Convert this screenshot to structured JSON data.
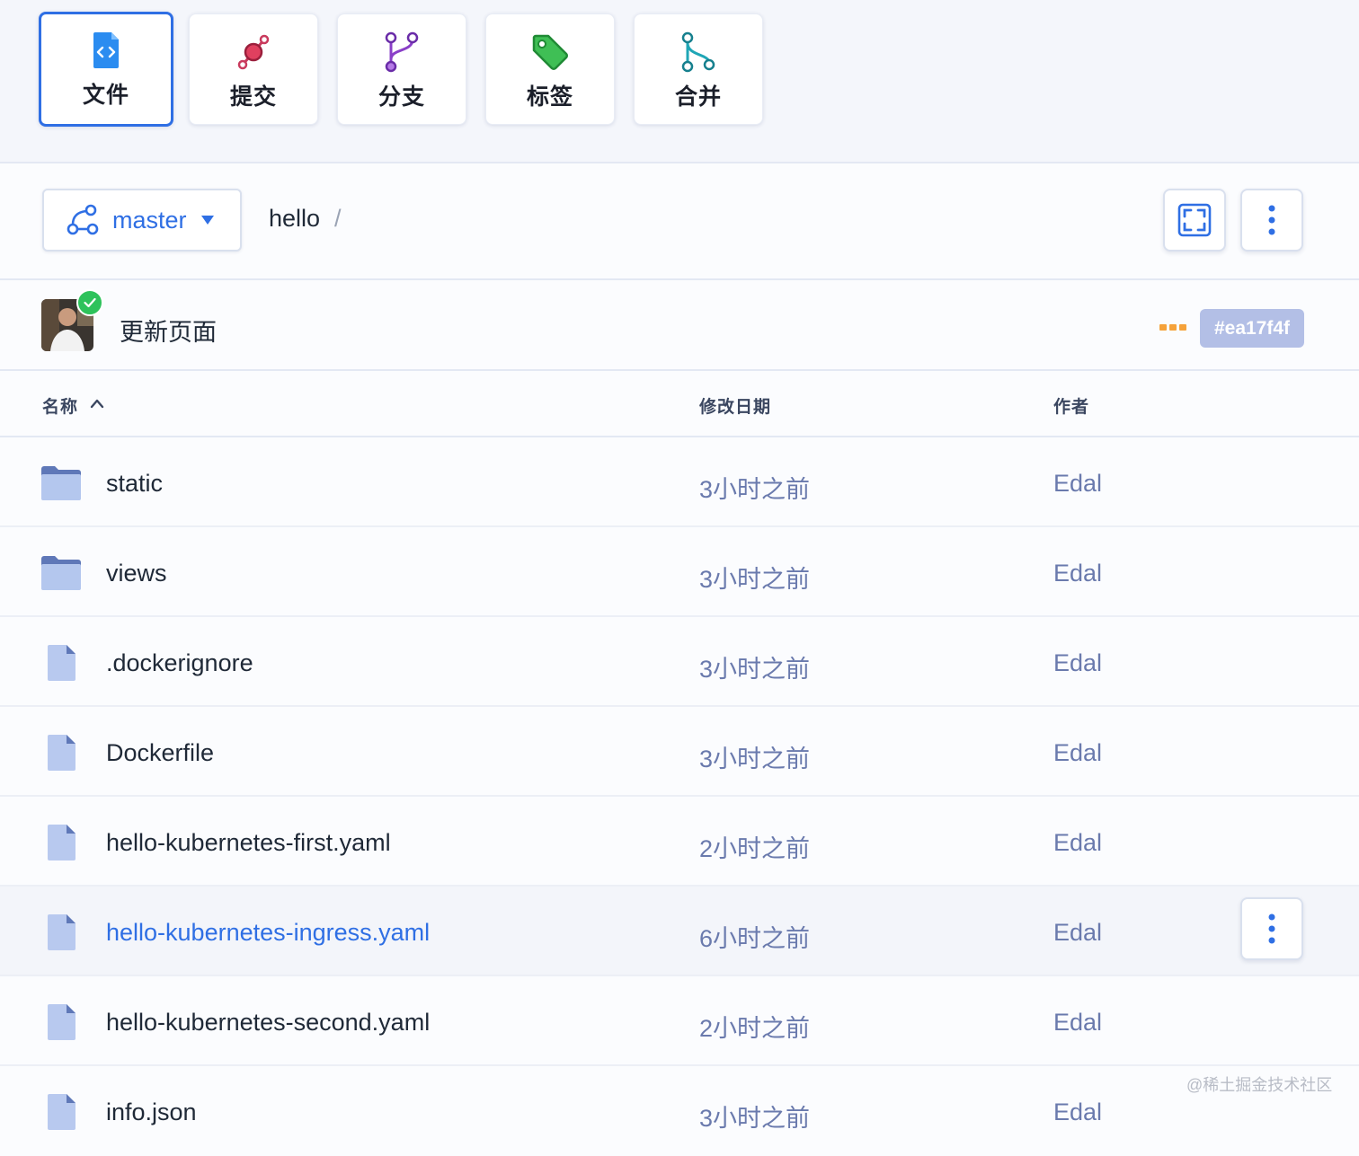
{
  "tabs": [
    {
      "label": "文件",
      "icon": "file-code-icon",
      "active": true
    },
    {
      "label": "提交",
      "icon": "commit-icon"
    },
    {
      "label": "分支",
      "icon": "branch-icon"
    },
    {
      "label": "标签",
      "icon": "tag-icon"
    },
    {
      "label": "合并",
      "icon": "merge-icon"
    }
  ],
  "toolbar": {
    "branch": "master",
    "breadcrumb": "hello",
    "breadcrumb_separator": "/"
  },
  "commit": {
    "message": "更新页面",
    "hash": "#ea17f4f"
  },
  "table": {
    "headers": {
      "name": "名称",
      "date": "修改日期",
      "author": "作者"
    },
    "rows": [
      {
        "name": "static",
        "type": "folder",
        "date": "3小时之前",
        "author": "Edal"
      },
      {
        "name": "views",
        "type": "folder",
        "date": "3小时之前",
        "author": "Edal"
      },
      {
        "name": ".dockerignore",
        "type": "file",
        "date": "3小时之前",
        "author": "Edal"
      },
      {
        "name": "Dockerfile",
        "type": "file",
        "date": "3小时之前",
        "author": "Edal"
      },
      {
        "name": "hello-kubernetes-first.yaml",
        "type": "file",
        "date": "2小时之前",
        "author": "Edal"
      },
      {
        "name": "hello-kubernetes-ingress.yaml",
        "type": "file",
        "date": "6小时之前",
        "author": "Edal",
        "hovered": true
      },
      {
        "name": "hello-kubernetes-second.yaml",
        "type": "file",
        "date": "2小时之前",
        "author": "Edal"
      },
      {
        "name": "info.json",
        "type": "file",
        "date": "3小时之前",
        "author": "Edal"
      }
    ]
  },
  "watermark": "@稀土掘金技术社区",
  "colors": {
    "accent": "#2f6fe4",
    "badge": "#b3bfe6",
    "folder": "#a9bde6",
    "file": "#b8c9ef"
  }
}
